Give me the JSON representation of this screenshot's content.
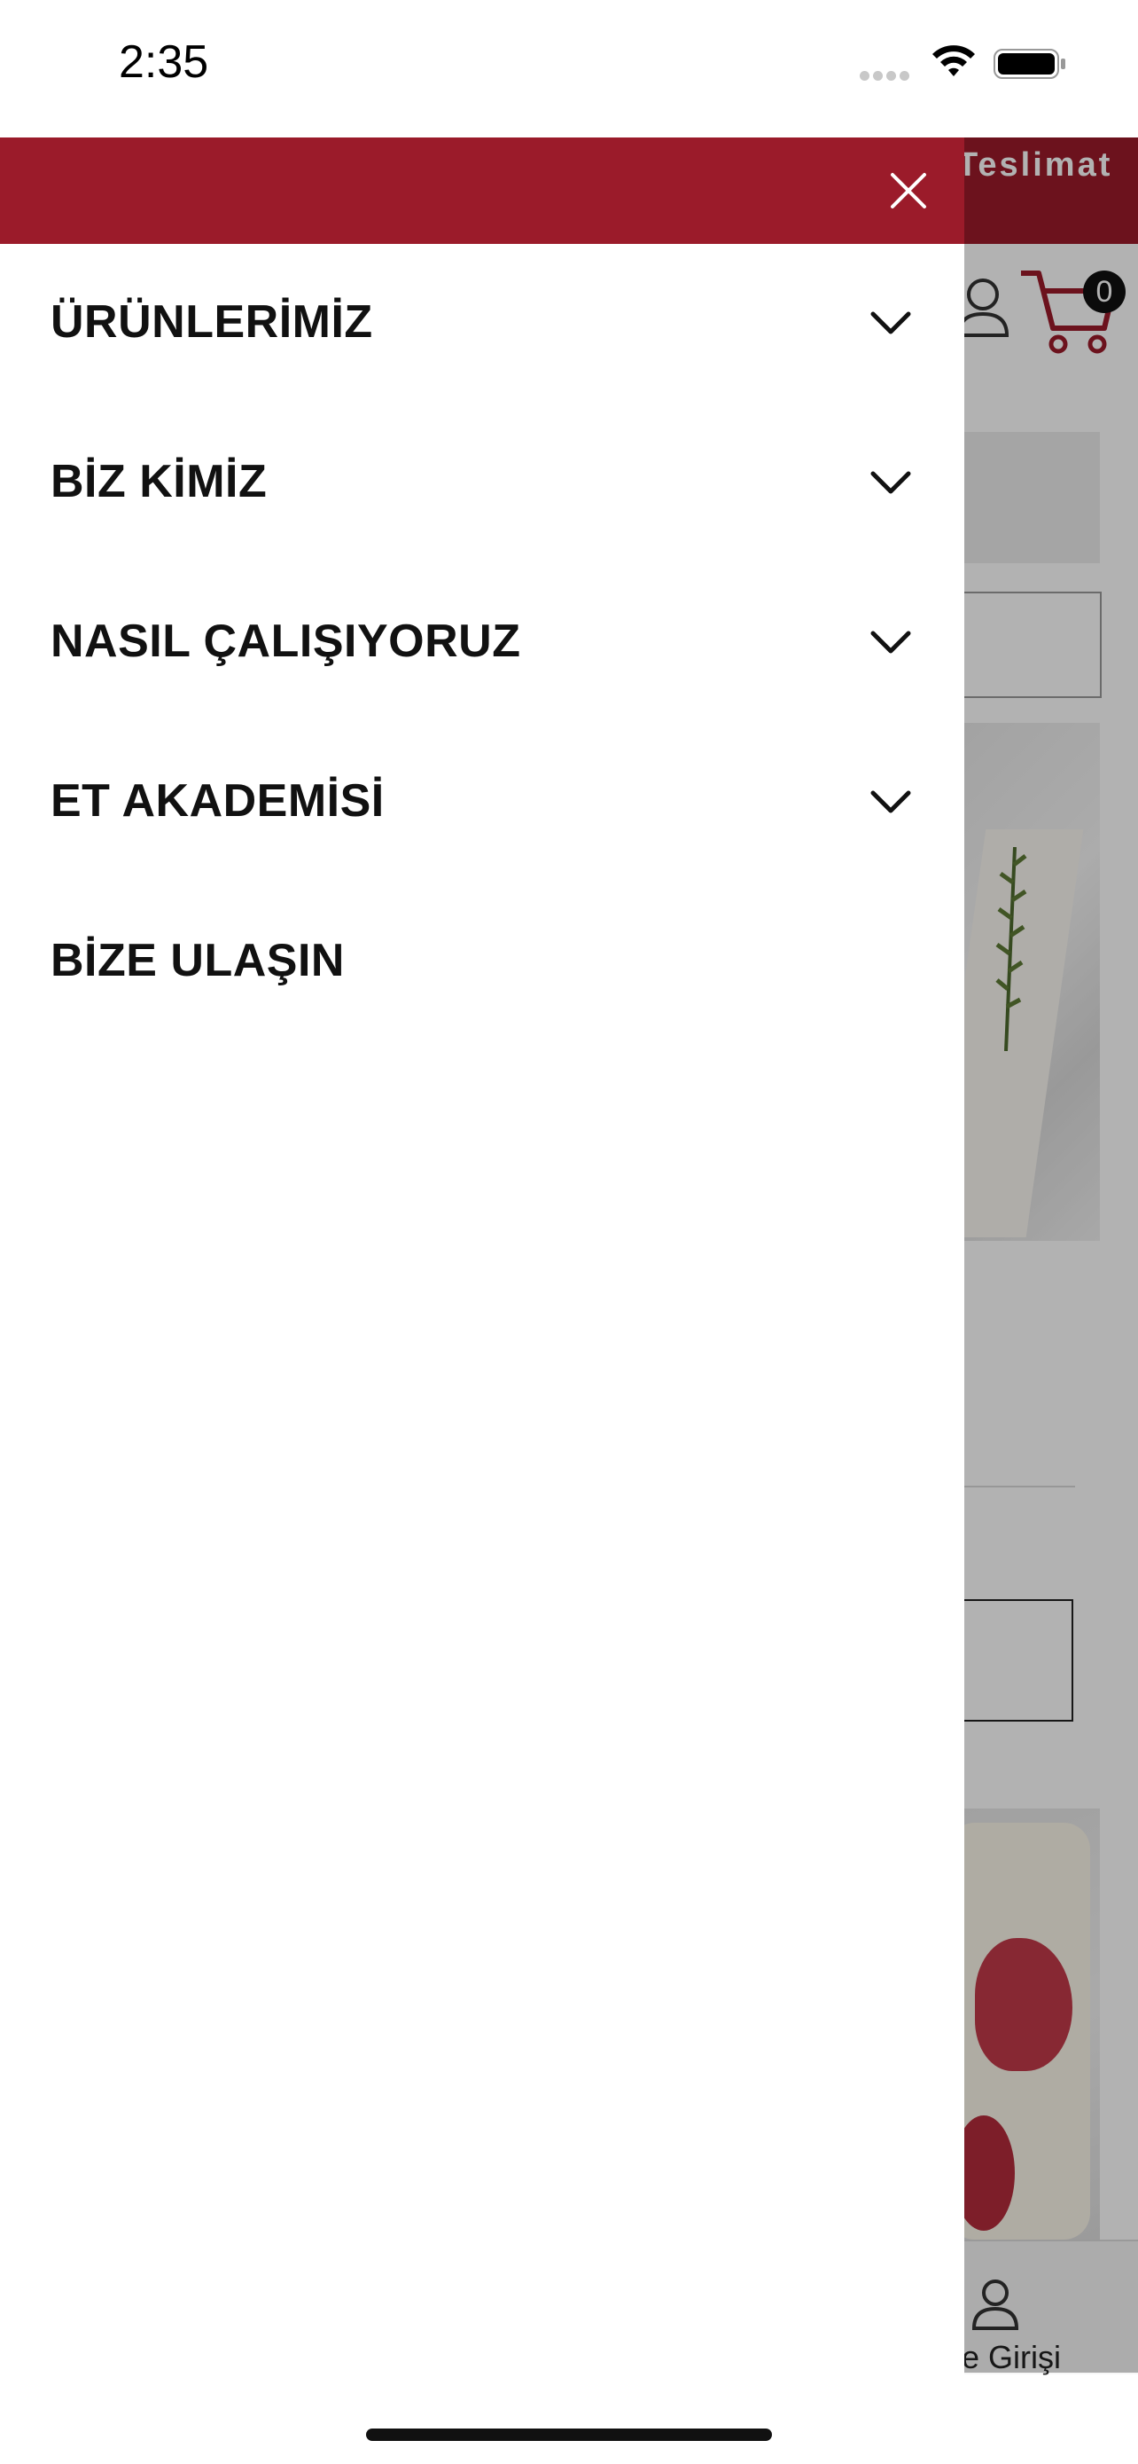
{
  "status_bar": {
    "time": "2:35",
    "icons": [
      "signal-dots-icon",
      "wifi-icon",
      "battery-icon"
    ]
  },
  "background_page": {
    "topbar_text": "Teslimat",
    "cart_count": "0",
    "tab_label": "e Girişi",
    "brand_color": "#9b1b2a",
    "overlay_color": "rgba(0,0,0,0.30)"
  },
  "drawer": {
    "header_color": "#9b1b2a",
    "close_icon": "close-icon",
    "menu": [
      {
        "label": "ÜRÜNLERİMİZ",
        "has_submenu": true
      },
      {
        "label": "BİZ KİMİZ",
        "has_submenu": true
      },
      {
        "label": "NASIL ÇALIŞIYORUZ",
        "has_submenu": true
      },
      {
        "label": "ET AKADEMİSİ",
        "has_submenu": true
      },
      {
        "label": "BİZE ULAŞIN",
        "has_submenu": false
      }
    ]
  }
}
